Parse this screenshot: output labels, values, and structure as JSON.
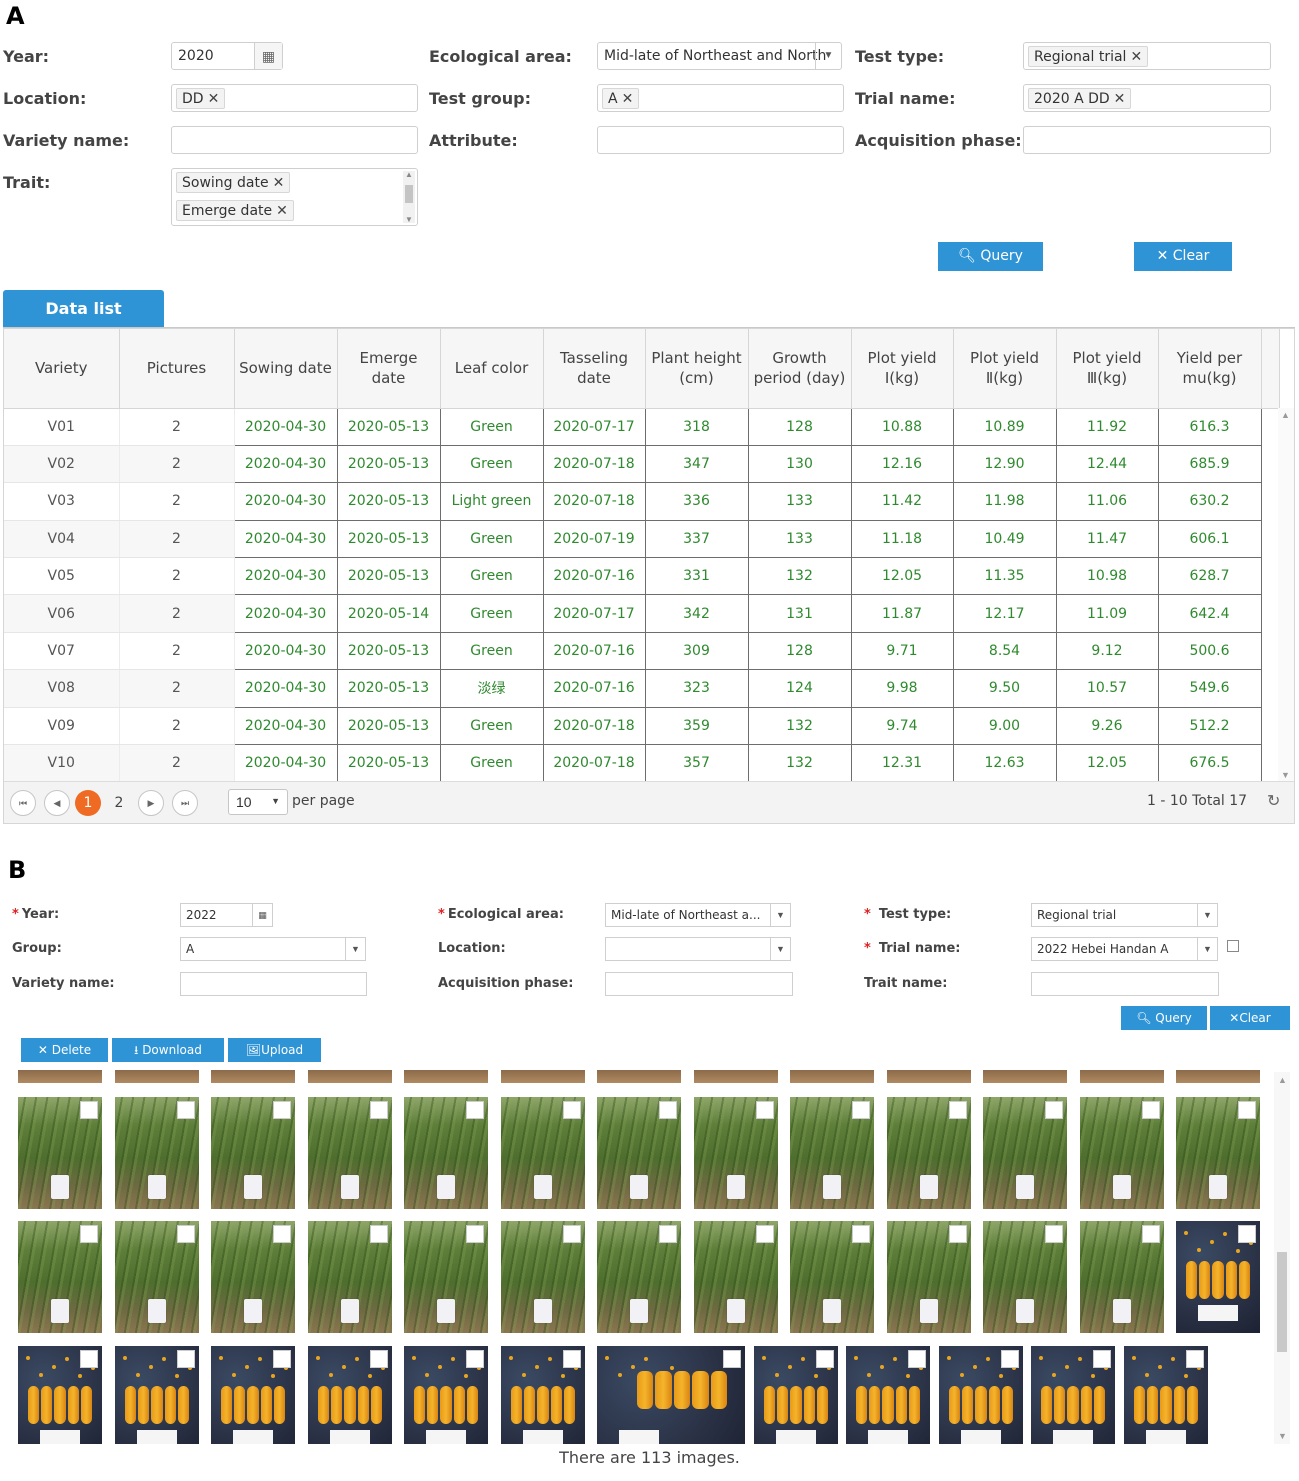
{
  "panel_a": {
    "letter": "A",
    "form": {
      "year_label": "Year:",
      "year_value": "2020",
      "eco_label": "Ecological area:",
      "eco_value": "Mid-late of Northeast and North",
      "test_type_label": "Test type:",
      "test_type_tag": "Regional trial",
      "location_label": "Location:",
      "location_tag": "DD",
      "group_label": "Test group:",
      "group_tag": "A",
      "trial_label": "Trial name:",
      "trial_tag": "2020 A DD",
      "variety_label": "Variety name:",
      "attribute_label": "Attribute:",
      "phase_label": "Acquisition phase:",
      "trait_label": "Trait:",
      "trait_tags": [
        "Sowing date",
        "Emerge date"
      ],
      "query_label": "Query",
      "clear_label": "Clear"
    },
    "tab_label": "Data list",
    "columns": [
      "Variety",
      "Pictures",
      "Sowing date",
      "Emerge date",
      "Leaf color",
      "Tasseling date",
      "Plant height (cm)",
      "Growth period (day)",
      "Plot yield Ⅰ(kg)",
      "Plot yield Ⅱ(kg)",
      "Plot yield Ⅲ(kg)",
      "Yield per mu(kg)"
    ],
    "rows": [
      [
        "V01",
        "2",
        "2020-04-30",
        "2020-05-13",
        "Green",
        "2020-07-17",
        "318",
        "128",
        "10.88",
        "10.89",
        "11.92",
        "616.3"
      ],
      [
        "V02",
        "2",
        "2020-04-30",
        "2020-05-13",
        "Green",
        "2020-07-18",
        "347",
        "130",
        "12.16",
        "12.90",
        "12.44",
        "685.9"
      ],
      [
        "V03",
        "2",
        "2020-04-30",
        "2020-05-13",
        "Light green",
        "2020-07-18",
        "336",
        "133",
        "11.42",
        "11.98",
        "11.06",
        "630.2"
      ],
      [
        "V04",
        "2",
        "2020-04-30",
        "2020-05-13",
        "Green",
        "2020-07-19",
        "337",
        "133",
        "11.18",
        "10.49",
        "11.47",
        "606.1"
      ],
      [
        "V05",
        "2",
        "2020-04-30",
        "2020-05-13",
        "Green",
        "2020-07-16",
        "331",
        "132",
        "12.05",
        "11.35",
        "10.98",
        "628.7"
      ],
      [
        "V06",
        "2",
        "2020-04-30",
        "2020-05-14",
        "Green",
        "2020-07-17",
        "342",
        "131",
        "11.87",
        "12.17",
        "11.09",
        "642.4"
      ],
      [
        "V07",
        "2",
        "2020-04-30",
        "2020-05-13",
        "Green",
        "2020-07-16",
        "309",
        "128",
        "9.71",
        "8.54",
        "9.12",
        "500.6"
      ],
      [
        "V08",
        "2",
        "2020-04-30",
        "2020-05-13",
        "淡绿",
        "2020-07-16",
        "323",
        "124",
        "9.98",
        "9.50",
        "10.57",
        "549.6"
      ],
      [
        "V09",
        "2",
        "2020-04-30",
        "2020-05-13",
        "Green",
        "2020-07-18",
        "359",
        "132",
        "9.74",
        "9.00",
        "9.26",
        "512.2"
      ],
      [
        "V10",
        "2",
        "2020-04-30",
        "2020-05-13",
        "Green",
        "2020-07-18",
        "357",
        "132",
        "12.31",
        "12.63",
        "12.05",
        "676.5"
      ]
    ],
    "pager": {
      "page1": "1",
      "page2": "2",
      "page_size": "10",
      "per_page": "per page",
      "summary": "1 - 10 Total 17"
    }
  },
  "panel_b": {
    "letter": "B",
    "form": {
      "year_label": "Year:",
      "year_value": "2022",
      "eco_label": "Ecological area:",
      "eco_value": "Mid-late of Northeast a...",
      "test_type_label": "Test type:",
      "test_type_value": "Regional trial",
      "group_label": "Group:",
      "group_value": "A",
      "location_label": "Location:",
      "location_value": "",
      "trial_label": "Trial name:",
      "trial_value": "2022 Hebei Handan A",
      "variety_label": "Variety name:",
      "phase_label": "Acquisition  phase:",
      "trait_label": "Trait name:",
      "query_label": "Query",
      "clear_label": "Clear",
      "delete_label": "Delete",
      "download_label": "Download",
      "upload_label": "Upload"
    },
    "footer": "There are 113 images."
  },
  "colors": {
    "accent": "#2e94d6",
    "active_page": "#ef6a22",
    "edited_cell_text": "#2f8a2f",
    "required": "#e02020"
  }
}
